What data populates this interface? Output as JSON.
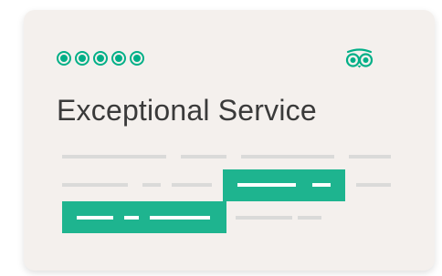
{
  "card": {
    "headline": "Exceptional Service",
    "rating": {
      "value": 5,
      "max": 5,
      "icon": "bubble-rating-icon",
      "color": "#00af87"
    },
    "logo": {
      "icon": "owl-eyes-logo-icon",
      "color": "#00af87"
    },
    "background": "#f4f0ed",
    "placeholder_text_color": "#dadad9",
    "highlight_color": "#1eb48f"
  }
}
